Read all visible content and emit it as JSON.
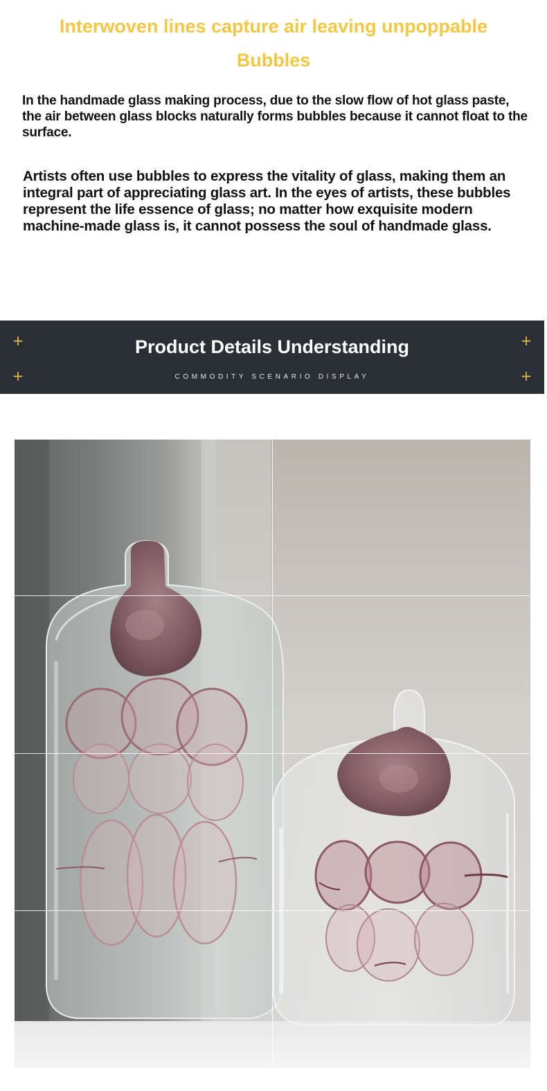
{
  "intro": {
    "headline": "Interwoven lines capture air leaving unpoppable Bubbles",
    "paragraph_1": "In the handmade glass making process, due to the slow flow of hot glass paste, the air between glass blocks naturally forms bubbles because it cannot float to the surface.",
    "paragraph_2": "Artists often use bubbles to express the vitality of glass, making them an integral part of appreciating glass art. In the eyes of artists, these bubbles represent the life essence of glass; no matter how exquisite modern machine-made glass is, it cannot possess the soul of handmade glass."
  },
  "banner": {
    "title": "Product Details Understanding",
    "subtitle": "COMMODITY SCENARIO DISPLAY",
    "background_color": "#2a2f36",
    "accent_icon": "plus-icon",
    "accent_color": "#e9b84a"
  },
  "photo": {
    "icon": "glass-vases-photo",
    "headline_color": "#f2c744"
  }
}
